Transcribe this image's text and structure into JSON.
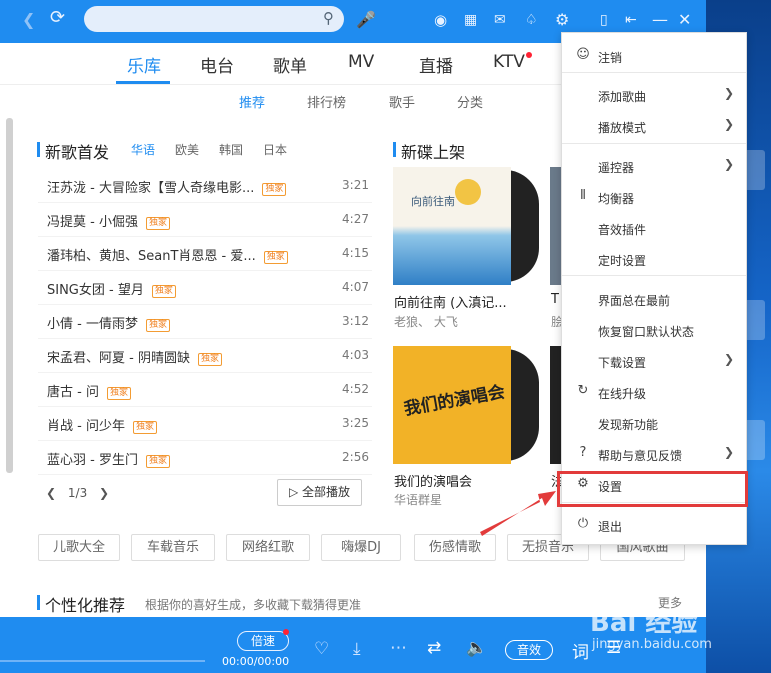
{
  "search": {
    "placeholder": ""
  },
  "nav": {
    "tabs": [
      "乐库",
      "电台",
      "歌单",
      "MV",
      "直播",
      "KTV"
    ],
    "active": "乐库"
  },
  "subnav": {
    "tabs": [
      "推荐",
      "排行榜",
      "歌手",
      "分类"
    ],
    "active": "推荐"
  },
  "new_songs": {
    "title": "新歌首发",
    "lang_tabs": [
      "华语",
      "欧美",
      "韩国",
      "日本"
    ],
    "items": [
      {
        "name": "汪苏泷 - 大冒险家【雪人奇缘电影...",
        "tag": "独家",
        "duration": "3:21"
      },
      {
        "name": "冯提莫 - 小倔强",
        "tag": "独家",
        "duration": "4:27"
      },
      {
        "name": "潘玮柏、黄旭、SeanT肖恩恩 - 爱...",
        "tag": "独家",
        "duration": "4:15"
      },
      {
        "name": "SING女团 - 望月",
        "tag": "独家",
        "duration": "4:07"
      },
      {
        "name": "小倩 - 一倩雨梦",
        "tag": "独家",
        "duration": "3:12"
      },
      {
        "name": "宋孟君、阿夏 - 阴晴圆缺",
        "tag": "独家",
        "duration": "4:03"
      },
      {
        "name": "唐古 - 问",
        "tag": "独家",
        "duration": "4:52"
      },
      {
        "name": "肖战 - 问少年",
        "tag": "独家",
        "duration": "3:25"
      },
      {
        "name": "蓝心羽 - 罗生门",
        "tag": "独家",
        "duration": "2:56"
      }
    ],
    "pager": "1/3",
    "play_all": "▷ 全部播放"
  },
  "new_albums": {
    "title": "新碟上架",
    "items": [
      {
        "title": "向前往南 (入滇记...",
        "artist": "老狼、 大飞",
        "cover_text": "向前往南"
      },
      {
        "title": "T",
        "artist": "脍"
      },
      {
        "title": "我们的演唱会",
        "artist": "华语群星",
        "cover_text": "我们的演唱会"
      },
      {
        "title": "法",
        "artist": ""
      }
    ]
  },
  "chips": [
    "儿歌大全",
    "车载音乐",
    "网络红歌",
    "嗨爆DJ",
    "伤感情歌",
    "无损音乐",
    "国风歌曲"
  ],
  "personal": {
    "title": "个性化推荐",
    "subtitle": "根据你的喜好生成，多收藏下载猜得更准",
    "more": "更多"
  },
  "player": {
    "speed": "倍速",
    "time": "00:00/00:00",
    "effect": "音效",
    "lyric": "词"
  },
  "menu": {
    "items": [
      {
        "label": "注销",
        "icon": "user-icon"
      },
      {
        "label": "添加歌曲",
        "arrow": true
      },
      {
        "label": "播放模式",
        "arrow": true
      },
      {
        "label": "遥控器",
        "arrow": true
      },
      {
        "label": "均衡器",
        "icon": "equalizer-icon"
      },
      {
        "label": "音效插件"
      },
      {
        "label": "定时设置"
      },
      {
        "label": "界面总在最前"
      },
      {
        "label": "恢复窗口默认状态"
      },
      {
        "label": "下载设置",
        "arrow": true
      },
      {
        "label": "在线升级",
        "icon": "upgrade-icon"
      },
      {
        "label": "发现新功能"
      },
      {
        "label": "帮助与意见反馈",
        "icon": "help-icon",
        "arrow": true
      },
      {
        "label": "设置",
        "icon": "gear-icon"
      },
      {
        "label": "退出",
        "icon": "power-icon"
      }
    ]
  },
  "watermark": {
    "logo": "Bai 经验",
    "url": "jingyan.baidu.com"
  },
  "colors": {
    "accent": "#1f8cf0",
    "highlight": "#e23b3b",
    "tag": "#f08020"
  }
}
